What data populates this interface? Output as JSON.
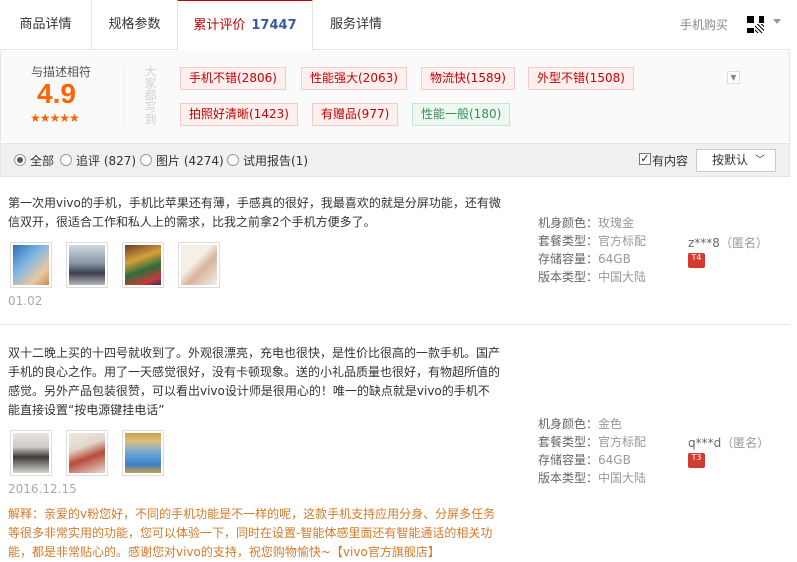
{
  "tabs": [
    {
      "label": "商品详情"
    },
    {
      "label": "规格参数"
    },
    {
      "label": "累计评价",
      "count": "17447"
    },
    {
      "label": "服务详情"
    }
  ],
  "buy_phone": "手机购买",
  "summary": {
    "match_label": "与描述相符",
    "score": "4.9",
    "stars": "★★★★★",
    "vertical_text": "大家都写到",
    "tags": [
      {
        "label": "手机不错(2806)",
        "tone": "positive"
      },
      {
        "label": "性能强大(2063)",
        "tone": "positive"
      },
      {
        "label": "物流快(1589)",
        "tone": "positive"
      },
      {
        "label": "外型不错(1508)",
        "tone": "positive"
      },
      {
        "label": "拍照好清晰(1423)",
        "tone": "positive"
      },
      {
        "label": "有赠品(977)",
        "tone": "positive"
      },
      {
        "label": "性能一般(180)",
        "tone": "neutral"
      }
    ]
  },
  "filters": {
    "options": [
      "全部",
      "追评 (827)",
      "图片 (4274)",
      "试用报告(1)"
    ],
    "selected": "全部",
    "has_content_label": "有内容",
    "has_content_checked": true,
    "sort_label": "按默认"
  },
  "reviews": [
    {
      "text": "第一次用vivo的手机，手机比苹果还有薄，手感真的很好，我最喜欢的就是分屏功能，还有微信双开，很适合工作和私人上的需求，比我之前拿2个手机方便多了。",
      "date": "01.02",
      "meta": [
        {
          "key": "机身颜色：",
          "value": "玫瑰金"
        },
        {
          "key": "套餐类型：",
          "value": "官方标配"
        },
        {
          "key": "存储容量：",
          "value": "64GB"
        },
        {
          "key": "版本类型：",
          "value": "中国大陆"
        }
      ],
      "user": "z***8",
      "anon": "（匿名）",
      "badge": "T4"
    },
    {
      "text": "双十二晚上买的十四号就收到了。外观很漂亮，充电也很快，是性价比很高的一款手机。国产手机的良心之作。用了一天感觉很好，没有卡顿现象。送的小礼品质量也很好，有物超所值的感觉。另外产品包装很赞，可以看出vivo设计师是很用心的！唯一的缺点就是vivo的手机不能直接设置“按电源键挂电话”",
      "date": "2016.12.15",
      "meta": [
        {
          "key": "机身颜色：",
          "value": "金色"
        },
        {
          "key": "套餐类型：",
          "value": "官方标配"
        },
        {
          "key": "存储容量：",
          "value": "64GB"
        },
        {
          "key": "版本类型：",
          "value": "中国大陆"
        }
      ],
      "user": "q***d",
      "anon": "（匿名）",
      "badge": "T3",
      "reply": "解释：亲爱的v粉您好，不同的手机功能是不一样的呢，这款手机支持应用分身、分屏多任务等很多非常实用的功能，您可以体验一下，同时在设置-智能体感里面还有智能通话的相关功能，都是非常贴心的。感谢您对vivo的支持，祝您购物愉快~【vivo官方旗舰店】"
    }
  ]
}
